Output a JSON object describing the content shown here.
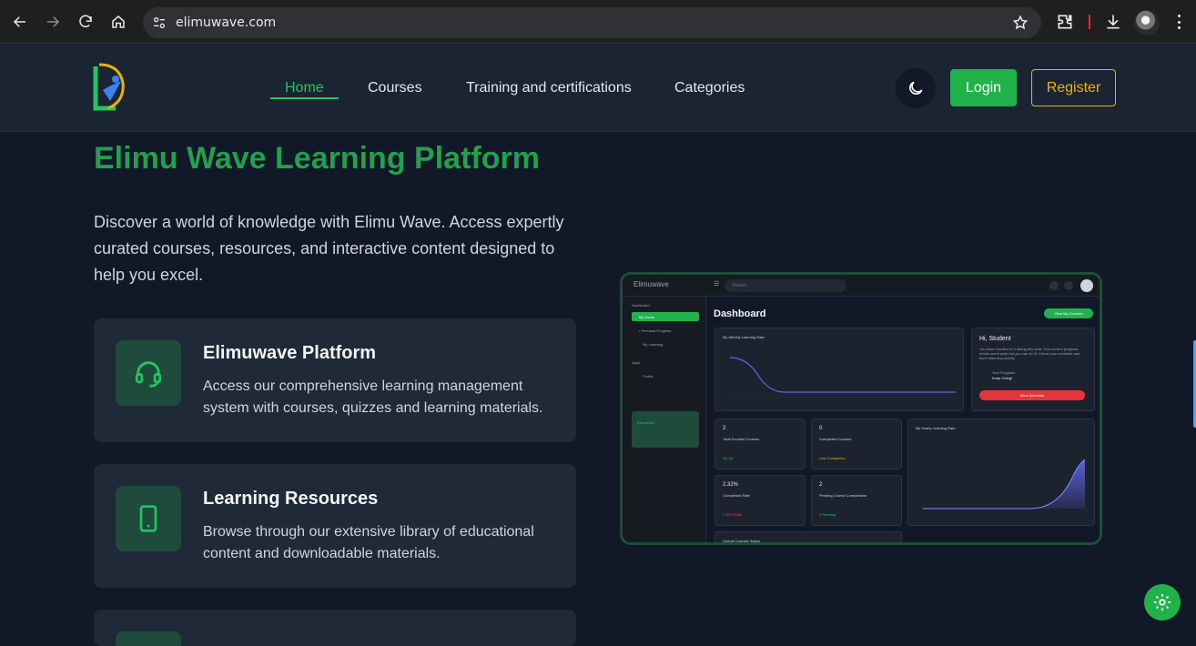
{
  "browser": {
    "url": "elimuwave.com"
  },
  "header": {
    "nav": [
      {
        "label": "Home",
        "active": true
      },
      {
        "label": "Courses",
        "active": false
      },
      {
        "label": "Training and certifications",
        "active": false
      },
      {
        "label": "Categories",
        "active": false
      }
    ],
    "login_label": "Login",
    "register_label": "Register"
  },
  "hero": {
    "title": "Elimu Wave Learning Platform",
    "description": "Discover a world of knowledge with Elimu Wave. Access expertly curated courses, resources, and interactive content designed to help you excel."
  },
  "cards": [
    {
      "icon": "headset-icon",
      "title": "Elimuwave Platform",
      "description": "Access our comprehensive learning management system with courses, quizzes and learning materials."
    },
    {
      "icon": "tablet-icon",
      "title": "Learning Resources",
      "description": "Browse through our extensive library of educational content and downloadable materials."
    }
  ],
  "preview": {
    "logo": "Elimuwave",
    "search_placeholder": "Search",
    "sidebar": {
      "section1": "Dashboard",
      "home": "My Home",
      "sub": "• Personal Progress",
      "learning": "My Learning",
      "section2": "Apps",
      "profile": "Profile",
      "promo": "Elimuwave"
    },
    "title": "Dashboard",
    "view_courses": "View My Courses",
    "weekly_chart_title": "My Weekly Learning Rate",
    "student": {
      "greeting": "Hi, Student",
      "text": "You have enrolled to 2 during this year. Your current progress needs some work but you can do it!. Check your schedule and don't miss any activity.",
      "progress_label": "Your Progress",
      "progress_value": "Keep Going!",
      "schedule_btn": "View Schedule"
    },
    "stats": [
      {
        "value": "2",
        "label": "Total Enrolled Courses",
        "foot": "On Up"
      },
      {
        "value": "0",
        "label": "Completed Courses",
        "foot": "Low Completion"
      },
      {
        "value": "2.32%",
        "label": "Completion Rate",
        "foot": "2.32% Rate"
      },
      {
        "value": "2",
        "label": "Pending Course Completions",
        "foot": "2 Pending"
      }
    ],
    "yearly_chart_title": "My Yearly Learning Rate",
    "bottom_title": "Overall Courses Status"
  }
}
